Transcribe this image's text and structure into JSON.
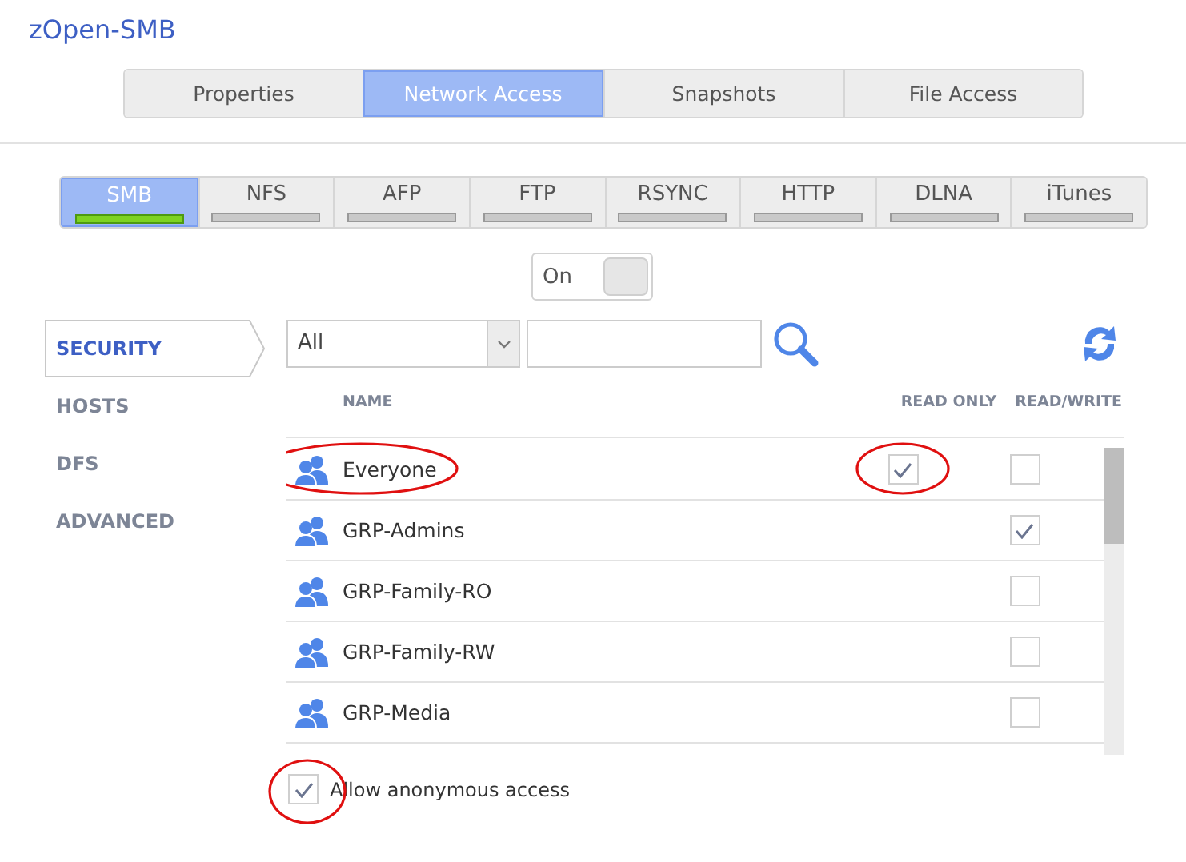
{
  "title": "zOpen-SMB",
  "tabs": [
    {
      "label": "Properties",
      "selected": false
    },
    {
      "label": "Network Access",
      "selected": true
    },
    {
      "label": "Snapshots",
      "selected": false
    },
    {
      "label": "File Access",
      "selected": false
    }
  ],
  "protocols": [
    {
      "label": "SMB",
      "selected": true,
      "on": true
    },
    {
      "label": "NFS",
      "selected": false,
      "on": false
    },
    {
      "label": "AFP",
      "selected": false,
      "on": false
    },
    {
      "label": "FTP",
      "selected": false,
      "on": false
    },
    {
      "label": "RSYNC",
      "selected": false,
      "on": false
    },
    {
      "label": "HTTP",
      "selected": false,
      "on": false
    },
    {
      "label": "DLNA",
      "selected": false,
      "on": false
    },
    {
      "label": "iTunes",
      "selected": false,
      "on": false
    }
  ],
  "toggle": {
    "label": "On",
    "on": true
  },
  "sidebar": {
    "items": [
      {
        "label": "SECURITY",
        "selected": true
      },
      {
        "label": "HOSTS",
        "selected": false
      },
      {
        "label": "DFS",
        "selected": false
      },
      {
        "label": "ADVANCED",
        "selected": false
      }
    ]
  },
  "filter": {
    "value": "All"
  },
  "table": {
    "columns": [
      "NAME",
      "READ ONLY",
      "READ/WRITE"
    ],
    "rows": [
      {
        "name": "Everyone",
        "read_only": true,
        "read_write": false,
        "circled": true
      },
      {
        "name": "GRP-Admins",
        "read_write": true,
        "circled": false
      },
      {
        "name": "GRP-Family-RO",
        "read_write": false,
        "circled": false
      },
      {
        "name": "GRP-Family-RW",
        "read_write": false,
        "circled": false
      },
      {
        "name": "GRP-Media",
        "read_write": false,
        "circled": false
      }
    ]
  },
  "anonymous": {
    "label": "Allow anonymous access",
    "checked": true,
    "circled": true
  }
}
